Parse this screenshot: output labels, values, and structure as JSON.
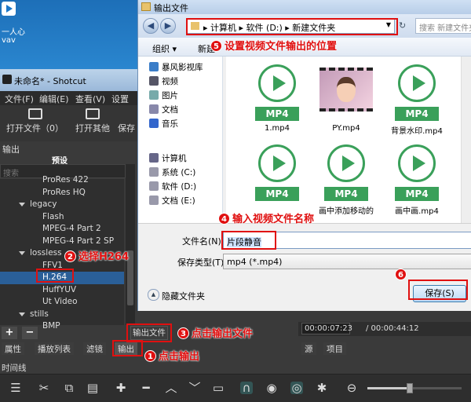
{
  "desktop": {
    "line1": "一人心",
    "line2": "vav"
  },
  "shotcut": {
    "title": "未命名* - Shotcut",
    "menu": [
      "文件(F)",
      "编辑(E)",
      "查看(V)",
      "设置"
    ],
    "toolbar": {
      "open": "打开文件（0）",
      "open_other": "打开其他",
      "save": "保存"
    },
    "panel_title": "输出",
    "presets_label": "预设",
    "search_placeholder": "搜索",
    "tree": [
      {
        "label": "ProRes 422",
        "level": 2
      },
      {
        "label": "ProRes HQ",
        "level": 2
      },
      {
        "label": "legacy",
        "level": 1
      },
      {
        "label": "Flash",
        "level": 2
      },
      {
        "label": "MPEG-4 Part 2",
        "level": 2
      },
      {
        "label": "MPEG-4 Part 2 SP",
        "level": 2
      },
      {
        "label": "lossless",
        "level": 1
      },
      {
        "label": "FFV1",
        "level": 2
      },
      {
        "label": "H.264",
        "level": 2,
        "selected": true
      },
      {
        "label": "HuffYUV",
        "level": 2
      },
      {
        "label": "Ut Video",
        "level": 2
      },
      {
        "label": "stills",
        "level": 1
      },
      {
        "label": "BMP",
        "level": 2
      }
    ],
    "add_label": "+",
    "remove_label": "−",
    "export_file_btn": "输出文件",
    "tabs": [
      "属性",
      "播放列表",
      "滤镜",
      "输出"
    ],
    "right_tabs": [
      "源",
      "项目"
    ],
    "timecode": "00:00:07:23",
    "duration": "/ 00:00:44:12",
    "timeline_label": "时间线"
  },
  "dialog": {
    "title": "输出文件",
    "breadcrumb": "▸ 计算机 ▸ 软件 (D:) ▸ 新建文件夹",
    "search_placeholder": "搜索 新建文件夹",
    "cmd": {
      "organize": "组织 ▾",
      "new_folder": "新建"
    },
    "nav": [
      {
        "label": "暴风影视库",
        "color": "#3a7dc8"
      },
      {
        "label": "视频",
        "color": "#556"
      },
      {
        "label": "图片",
        "color": "#7aa"
      },
      {
        "label": "文档",
        "color": "#88a"
      },
      {
        "label": "音乐",
        "color": "#36c"
      },
      {
        "label": "计算机",
        "color": "#668"
      },
      {
        "label": "系统 (C:)",
        "color": "#99a"
      },
      {
        "label": "软件 (D:)",
        "color": "#99a"
      },
      {
        "label": "文档 (E:)",
        "color": "#99a"
      }
    ],
    "files": [
      {
        "name": "1.mp4",
        "type": "mp4",
        "badge": "MP4"
      },
      {
        "name": "PY.mp4",
        "type": "video",
        "badge": ""
      },
      {
        "name": "背景水印.mp4",
        "type": "mp4",
        "badge": "MP4"
      },
      {
        "name": "",
        "type": "mp4",
        "badge": "MP4"
      },
      {
        "name": "画中添加移动的.mp4",
        "type": "mp4",
        "badge": "MP4"
      },
      {
        "name": "画中画.mp4",
        "type": "mp4",
        "badge": "MP4"
      }
    ],
    "filename_label": "文件名(N):",
    "filename_value": "片段静音",
    "filetype_label": "保存类型(T):",
    "filetype_value": "mp4 (*.mp4)",
    "hide_folders": "隐藏文件夹",
    "save_button": "保存(S)"
  },
  "annotations": [
    {
      "num": "1",
      "text": "点击输出"
    },
    {
      "num": "2",
      "text": "选择H264"
    },
    {
      "num": "3",
      "text": "点击输出文件"
    },
    {
      "num": "4",
      "text": "输入视频文件名称"
    },
    {
      "num": "5",
      "text": "设置视频文件输出的位置"
    },
    {
      "num": "6",
      "text": ""
    }
  ],
  "colors": {
    "annotation": "#e01010",
    "mp4_green": "#3aa05a",
    "selection": "#2a5f98"
  }
}
